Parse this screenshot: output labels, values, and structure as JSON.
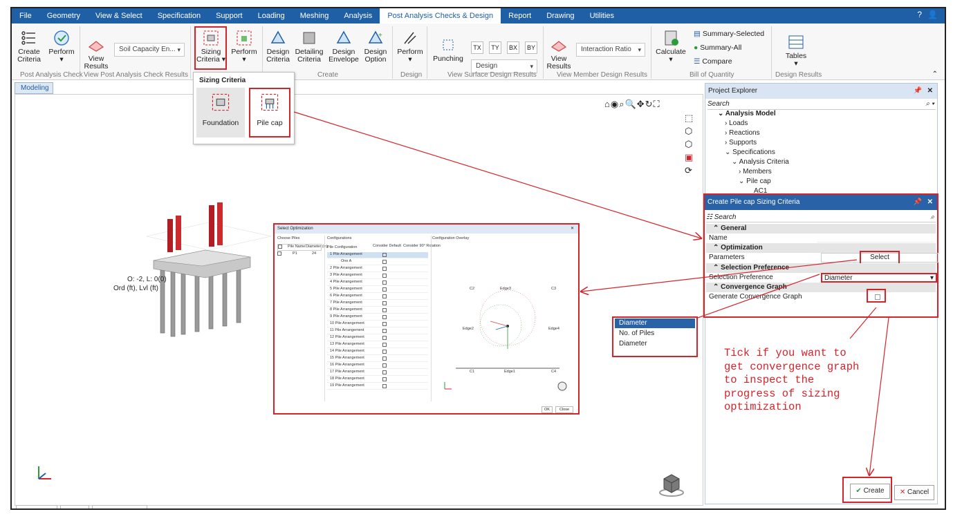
{
  "menu": [
    "File",
    "Geometry",
    "View & Select",
    "Specification",
    "Support",
    "Loading",
    "Meshing",
    "Analysis",
    "Post Analysis Checks & Design",
    "Report",
    "Drawing",
    "Utilities"
  ],
  "menu_active": "Post Analysis Checks & Design",
  "ribbon": {
    "create_criteria": "Create\nCriteria",
    "perform1": "Perform",
    "view_results1": "View\nResults",
    "soil_capacity": "Soil Capacity En...",
    "sizing_criteria": "Sizing\nCriteria ▾",
    "perform2": "Perform",
    "design_criteria": "Design\nCriteria",
    "detailing_criteria": "Detailing\nCriteria",
    "design_envelope": "Design\nEnvelope",
    "design_option": "Design\nOption",
    "perform3": "Perform",
    "punching": "Punching",
    "tx": "TX",
    "ty": "TY",
    "bx": "BX",
    "by": "BY",
    "design_dd": "Design",
    "view_results2": "View\nResults",
    "interaction_ratio": "Interaction Ratio",
    "calculate": "Calculate",
    "summary_selected": "Summary-Selected",
    "summary_all": "Summary-All",
    "compare": "Compare",
    "tables": "Tables",
    "groups": {
      "post_analysis_check": "Post Analysis Check",
      "view_post": "View Post Analysis Check Results",
      "create": "Create",
      "design": "Design",
      "view_surface": "View Surface Design Results",
      "view_member": "View Member Design Results",
      "boq": "Bill of Quantity",
      "design_results": "Design Results"
    }
  },
  "sizing_popup": {
    "title": "Sizing Criteria",
    "foundation": "Foundation",
    "pile_cap": "Pile cap"
  },
  "tabs": {
    "modeling": "Modeling"
  },
  "viewport": {
    "coord_line1": "O: -2, L: 0(0)",
    "coord_line2": "Ord (ft), Lvl (ft)"
  },
  "project_explorer": {
    "title": "Project Explorer",
    "search": "Search",
    "items": [
      "Analysis Model",
      "Loads",
      "Reactions",
      "Supports",
      "Specifications",
      "Analysis Criteria",
      "Members",
      "Pile cap",
      "AC1"
    ]
  },
  "dialog": {
    "title": "Create Pile cap Sizing Criteria",
    "search": "Search",
    "general": "General",
    "name": "Name",
    "optimization": "Optimization",
    "parameters": "Parameters",
    "select_btn": "Select",
    "selection_pref_section": "Selection Preference",
    "selection_pref": "Selection Preference",
    "selection_value": "Diameter",
    "convergence_section": "Convergence Graph",
    "generate_convergence": "Generate Convergence Graph",
    "create": "Create",
    "cancel": "Cancel"
  },
  "pref_list": [
    "Diameter",
    "No. of Piles",
    "Diameter"
  ],
  "select_optimization": {
    "title": "Select Optimization",
    "choose_piles": "Choose Piles",
    "pile_name": "Pile Name",
    "diameter_in": "Diameter (in)",
    "pile_row_name": "P1",
    "pile_row_dia": "24",
    "configurations": "Configurations",
    "pile_configuration": "Pile Configuration",
    "consider_default": "Consider Default",
    "consider_90": "Consider 90° Rotation",
    "config_overlay": "Configuration Overlay",
    "rows": [
      "1 Pile Arrangement",
      "One A",
      "2 Pile Arrangement",
      "3 Pile Arrangement",
      "4 Pile Arrangement",
      "5 Pile Arrangement",
      "6 Pile Arrangement",
      "7 Pile Arrangement",
      "8 Pile Arrangement",
      "9 Pile Arrangement",
      "10 Pile Arrangement",
      "11 Pile Arrangement",
      "12 Pile Arrangement",
      "13 Pile Arrangement",
      "14 Pile Arrangement",
      "15 Pile Arrangement",
      "16 Pile Arrangement",
      "17 Pile Arrangement",
      "18 Pile Arrangement",
      "19 Pile Arrangement"
    ],
    "labels": {
      "c1": "C1",
      "c2": "C2",
      "c3": "C3",
      "c4": "C4",
      "edge1": "Edge1",
      "edge2": "Edge2",
      "edge3": "Edge3",
      "edge4": "Edge4"
    },
    "ok": "OK",
    "close": "Close"
  },
  "annotation": [
    "Tick if you want to",
    "get convergence graph",
    "to inspect the",
    "progress of sizing",
    "optimization"
  ],
  "colors": {
    "accent": "#1f5fa6",
    "highlight": "#d6232a"
  }
}
